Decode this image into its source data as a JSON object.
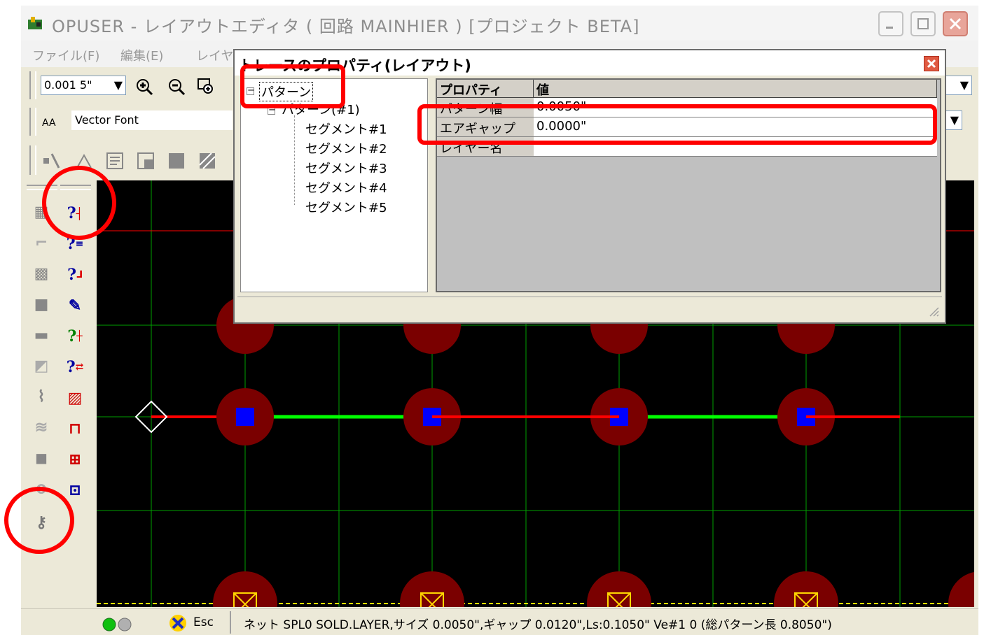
{
  "window": {
    "title": "OPUSER - レイアウトエディタ ( 回路 MAINHIER ) [プロジェクト BETA]",
    "menu": [
      "ファイル(F)",
      "編集(E)",
      "レイヤ"
    ]
  },
  "toolbar": {
    "grid_value": "0.001 5\"",
    "font_label": "Vector Font",
    "font_prefix": "AA"
  },
  "dialog": {
    "title": "トレースのプロパティ(レイアウト)",
    "tree": {
      "root": "パターン",
      "child": "パターン(#1)",
      "segments": [
        "セグメント#1",
        "セグメント#2",
        "セグメント#3",
        "セグメント#4",
        "セグメント#5"
      ]
    },
    "grid": {
      "header_property": "プロパティ",
      "header_value": "値",
      "rows": [
        {
          "name": "パターン幅",
          "value": "0.0050\""
        },
        {
          "name": "エアギャップ",
          "value": "0.0000\""
        },
        {
          "name": "レイヤー名",
          "value": ""
        }
      ]
    }
  },
  "status": {
    "esc_label": "Esc",
    "text": "ネット SPL0 SOLD.LAYER,サイズ 0.0050\",ギャップ 0.0120\",Ls:0.1050\" Ve#1 0 (総パターン長 0.8050\")"
  },
  "colors": {
    "canvas_bg": "#000000",
    "grid_line": "#00a000",
    "pad_ring": "#7a0000",
    "pad_core": "#0000ff",
    "trace_red": "#ff0000",
    "trace_green": "#00ff00",
    "annotation": "#ff0000"
  }
}
